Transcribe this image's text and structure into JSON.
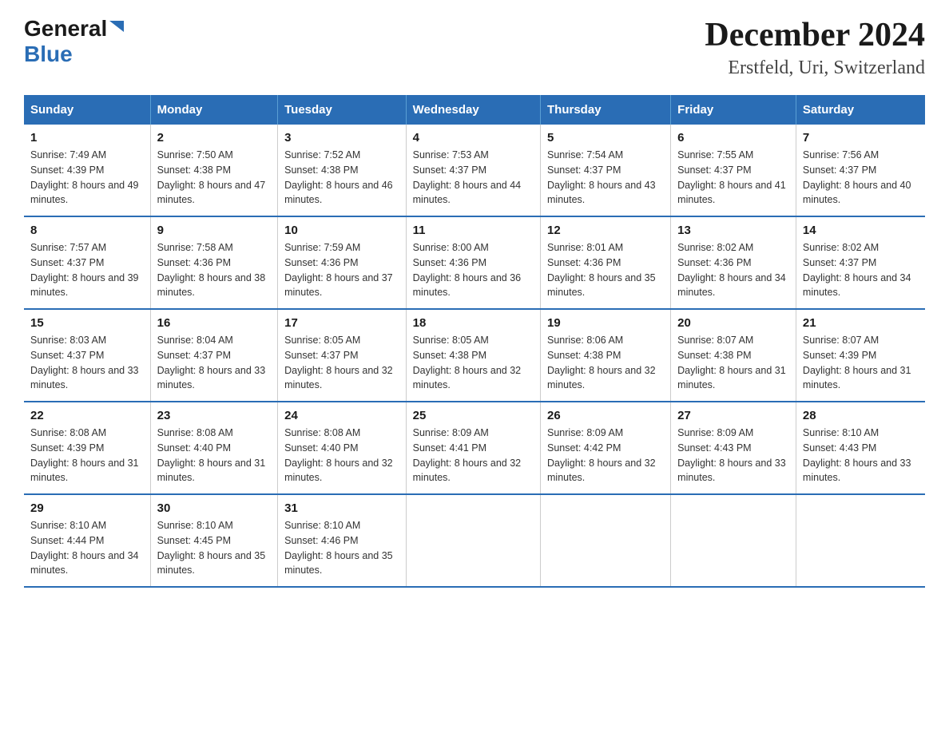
{
  "header": {
    "logo_general": "General",
    "logo_blue": "Blue",
    "title": "December 2024",
    "subtitle": "Erstfeld, Uri, Switzerland"
  },
  "columns": [
    "Sunday",
    "Monday",
    "Tuesday",
    "Wednesday",
    "Thursday",
    "Friday",
    "Saturday"
  ],
  "weeks": [
    [
      {
        "day": "1",
        "sunrise": "7:49 AM",
        "sunset": "4:39 PM",
        "daylight": "8 hours and 49 minutes."
      },
      {
        "day": "2",
        "sunrise": "7:50 AM",
        "sunset": "4:38 PM",
        "daylight": "8 hours and 47 minutes."
      },
      {
        "day": "3",
        "sunrise": "7:52 AM",
        "sunset": "4:38 PM",
        "daylight": "8 hours and 46 minutes."
      },
      {
        "day": "4",
        "sunrise": "7:53 AM",
        "sunset": "4:37 PM",
        "daylight": "8 hours and 44 minutes."
      },
      {
        "day": "5",
        "sunrise": "7:54 AM",
        "sunset": "4:37 PM",
        "daylight": "8 hours and 43 minutes."
      },
      {
        "day": "6",
        "sunrise": "7:55 AM",
        "sunset": "4:37 PM",
        "daylight": "8 hours and 41 minutes."
      },
      {
        "day": "7",
        "sunrise": "7:56 AM",
        "sunset": "4:37 PM",
        "daylight": "8 hours and 40 minutes."
      }
    ],
    [
      {
        "day": "8",
        "sunrise": "7:57 AM",
        "sunset": "4:37 PM",
        "daylight": "8 hours and 39 minutes."
      },
      {
        "day": "9",
        "sunrise": "7:58 AM",
        "sunset": "4:36 PM",
        "daylight": "8 hours and 38 minutes."
      },
      {
        "day": "10",
        "sunrise": "7:59 AM",
        "sunset": "4:36 PM",
        "daylight": "8 hours and 37 minutes."
      },
      {
        "day": "11",
        "sunrise": "8:00 AM",
        "sunset": "4:36 PM",
        "daylight": "8 hours and 36 minutes."
      },
      {
        "day": "12",
        "sunrise": "8:01 AM",
        "sunset": "4:36 PM",
        "daylight": "8 hours and 35 minutes."
      },
      {
        "day": "13",
        "sunrise": "8:02 AM",
        "sunset": "4:36 PM",
        "daylight": "8 hours and 34 minutes."
      },
      {
        "day": "14",
        "sunrise": "8:02 AM",
        "sunset": "4:37 PM",
        "daylight": "8 hours and 34 minutes."
      }
    ],
    [
      {
        "day": "15",
        "sunrise": "8:03 AM",
        "sunset": "4:37 PM",
        "daylight": "8 hours and 33 minutes."
      },
      {
        "day": "16",
        "sunrise": "8:04 AM",
        "sunset": "4:37 PM",
        "daylight": "8 hours and 33 minutes."
      },
      {
        "day": "17",
        "sunrise": "8:05 AM",
        "sunset": "4:37 PM",
        "daylight": "8 hours and 32 minutes."
      },
      {
        "day": "18",
        "sunrise": "8:05 AM",
        "sunset": "4:38 PM",
        "daylight": "8 hours and 32 minutes."
      },
      {
        "day": "19",
        "sunrise": "8:06 AM",
        "sunset": "4:38 PM",
        "daylight": "8 hours and 32 minutes."
      },
      {
        "day": "20",
        "sunrise": "8:07 AM",
        "sunset": "4:38 PM",
        "daylight": "8 hours and 31 minutes."
      },
      {
        "day": "21",
        "sunrise": "8:07 AM",
        "sunset": "4:39 PM",
        "daylight": "8 hours and 31 minutes."
      }
    ],
    [
      {
        "day": "22",
        "sunrise": "8:08 AM",
        "sunset": "4:39 PM",
        "daylight": "8 hours and 31 minutes."
      },
      {
        "day": "23",
        "sunrise": "8:08 AM",
        "sunset": "4:40 PM",
        "daylight": "8 hours and 31 minutes."
      },
      {
        "day": "24",
        "sunrise": "8:08 AM",
        "sunset": "4:40 PM",
        "daylight": "8 hours and 32 minutes."
      },
      {
        "day": "25",
        "sunrise": "8:09 AM",
        "sunset": "4:41 PM",
        "daylight": "8 hours and 32 minutes."
      },
      {
        "day": "26",
        "sunrise": "8:09 AM",
        "sunset": "4:42 PM",
        "daylight": "8 hours and 32 minutes."
      },
      {
        "day": "27",
        "sunrise": "8:09 AM",
        "sunset": "4:43 PM",
        "daylight": "8 hours and 33 minutes."
      },
      {
        "day": "28",
        "sunrise": "8:10 AM",
        "sunset": "4:43 PM",
        "daylight": "8 hours and 33 minutes."
      }
    ],
    [
      {
        "day": "29",
        "sunrise": "8:10 AM",
        "sunset": "4:44 PM",
        "daylight": "8 hours and 34 minutes."
      },
      {
        "day": "30",
        "sunrise": "8:10 AM",
        "sunset": "4:45 PM",
        "daylight": "8 hours and 35 minutes."
      },
      {
        "day": "31",
        "sunrise": "8:10 AM",
        "sunset": "4:46 PM",
        "daylight": "8 hours and 35 minutes."
      },
      null,
      null,
      null,
      null
    ]
  ],
  "labels": {
    "sunrise_prefix": "Sunrise: ",
    "sunset_prefix": "Sunset: ",
    "daylight_prefix": "Daylight: "
  }
}
